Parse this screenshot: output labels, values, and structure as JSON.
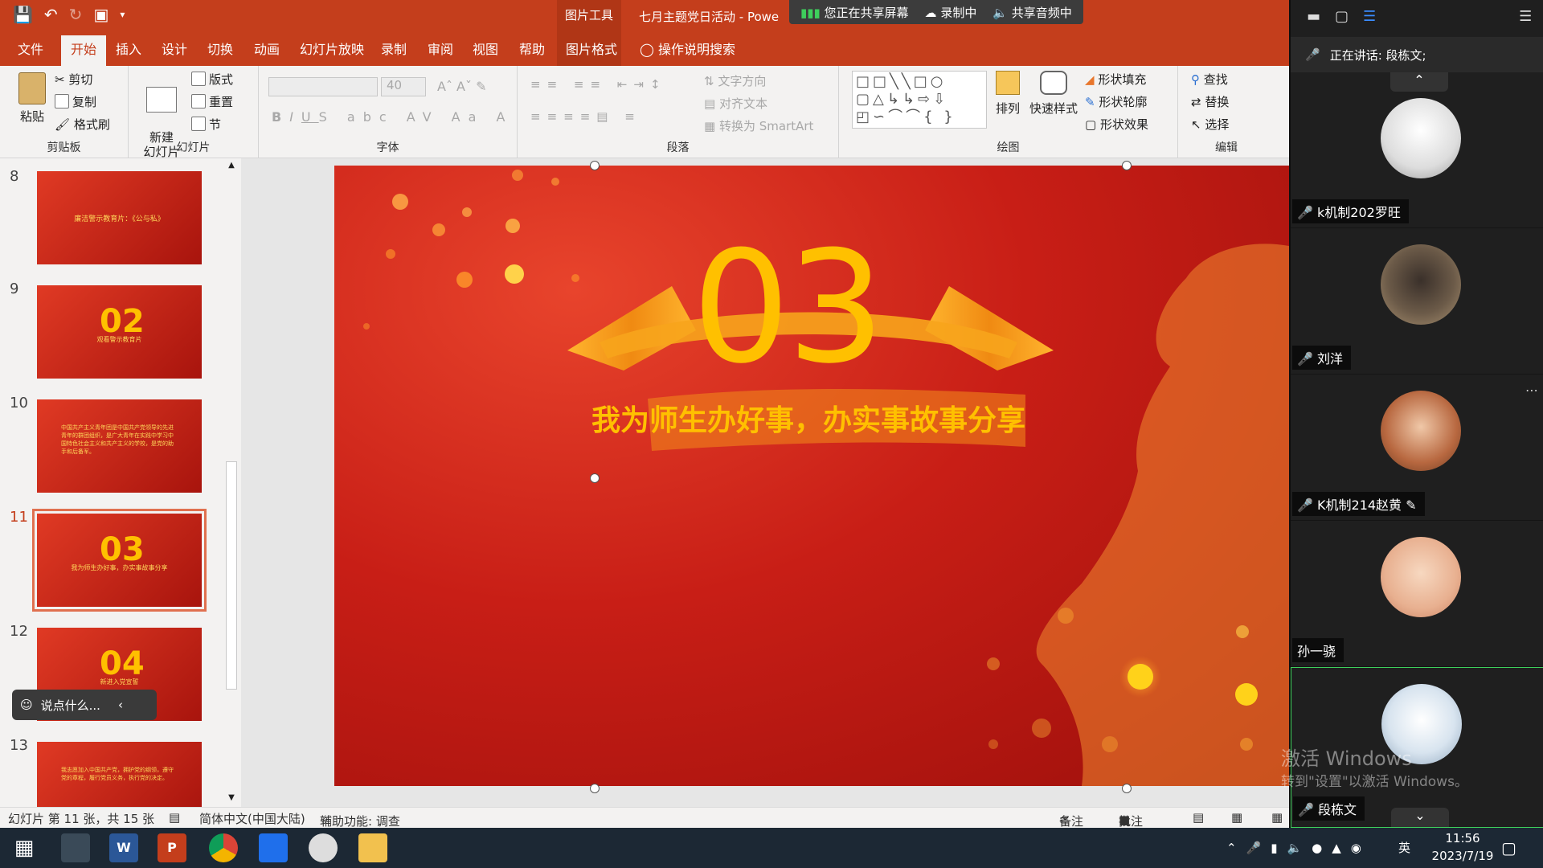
{
  "titlebar": {
    "context_tab": "图片工具",
    "doc_title": "七月主题党日活动 - Powe",
    "share_screen": "您正在共享屏幕",
    "recording": "录制中",
    "share_audio": "共享音频中"
  },
  "tabs": [
    {
      "label": "文件"
    },
    {
      "label": "开始"
    },
    {
      "label": "插入"
    },
    {
      "label": "设计"
    },
    {
      "label": "切换"
    },
    {
      "label": "动画"
    },
    {
      "label": "幻灯片放映"
    },
    {
      "label": "录制"
    },
    {
      "label": "审阅"
    },
    {
      "label": "视图"
    },
    {
      "label": "帮助"
    },
    {
      "label": "图片格式"
    }
  ],
  "tell_me": "操作说明搜索",
  "ribbon": {
    "clipboard": {
      "paste": "粘贴",
      "cut": "剪切",
      "copy": "复制",
      "format_painter": "格式刷",
      "label": "剪贴板"
    },
    "slides": {
      "new_slide": "新建\n幻灯片",
      "layout": "版式",
      "reset": "重置",
      "section": "节",
      "label": "幻灯片"
    },
    "font": {
      "font_size": "40",
      "label": "字体"
    },
    "paragraph": {
      "text_direction": "文字方向",
      "align_text": "对齐文本",
      "smartart": "转换为 SmartArt",
      "label": "段落"
    },
    "drawing": {
      "arrange": "排列",
      "quick_styles": "快速样式",
      "shape_fill": "形状填充",
      "shape_outline": "形状轮廓",
      "shape_effects": "形状效果",
      "label": "绘图"
    },
    "editing": {
      "find": "查找",
      "replace": "替换",
      "select": "选择",
      "label": "编辑"
    }
  },
  "thumbnails": [
    {
      "num": "8",
      "big": "",
      "caption": "廉洁警示教育片：《公与私》"
    },
    {
      "num": "9",
      "big": "02",
      "caption": "观看警示教育片"
    },
    {
      "num": "10",
      "big": "",
      "caption": "中国共产主义青年团是中国共产党领导的先进青年的群团组织，是广大青年在实践中学习中国特色社会主义和共产主义的学校，是党的助手和后备军。"
    },
    {
      "num": "11",
      "big": "03",
      "caption": "我为师生办好事，办实事故事分享"
    },
    {
      "num": "12",
      "big": "04",
      "caption": "新进入党宣誓"
    },
    {
      "num": "13",
      "big": "",
      "caption": "我志愿加入中国共产党，拥护党的纲领，遵守党的章程，履行党员义务，执行党的决定。"
    }
  ],
  "chat_placeholder": "说点什么...",
  "slide": {
    "number": "03",
    "subtitle": "我为师生办好事，办实事故事分享"
  },
  "status": {
    "slide_info": "幻灯片 第 11 张，共 15 张",
    "language": "简体中文(中国大陆)",
    "accessibility": "辅助功能: 调查",
    "notes": "备注",
    "comments": "批注"
  },
  "meeting": {
    "speaking": "正在讲话:  段栋文;",
    "participants": [
      {
        "name": "k机制202罗旺"
      },
      {
        "name": "刘洋"
      },
      {
        "name": "K机制214赵黄"
      },
      {
        "name": "孙一骁"
      },
      {
        "name": "段栋文"
      }
    ]
  },
  "watermark": {
    "line1": "激活 Windows",
    "line2": "转到\"设置\"以激活 Windows。"
  },
  "taskbar": {
    "ime": "英",
    "time": "11:56",
    "date": "2023/7/19"
  },
  "colors": {
    "accent": "#c43e1c",
    "slide_red": "#c81e16",
    "gold": "#ffc000"
  }
}
